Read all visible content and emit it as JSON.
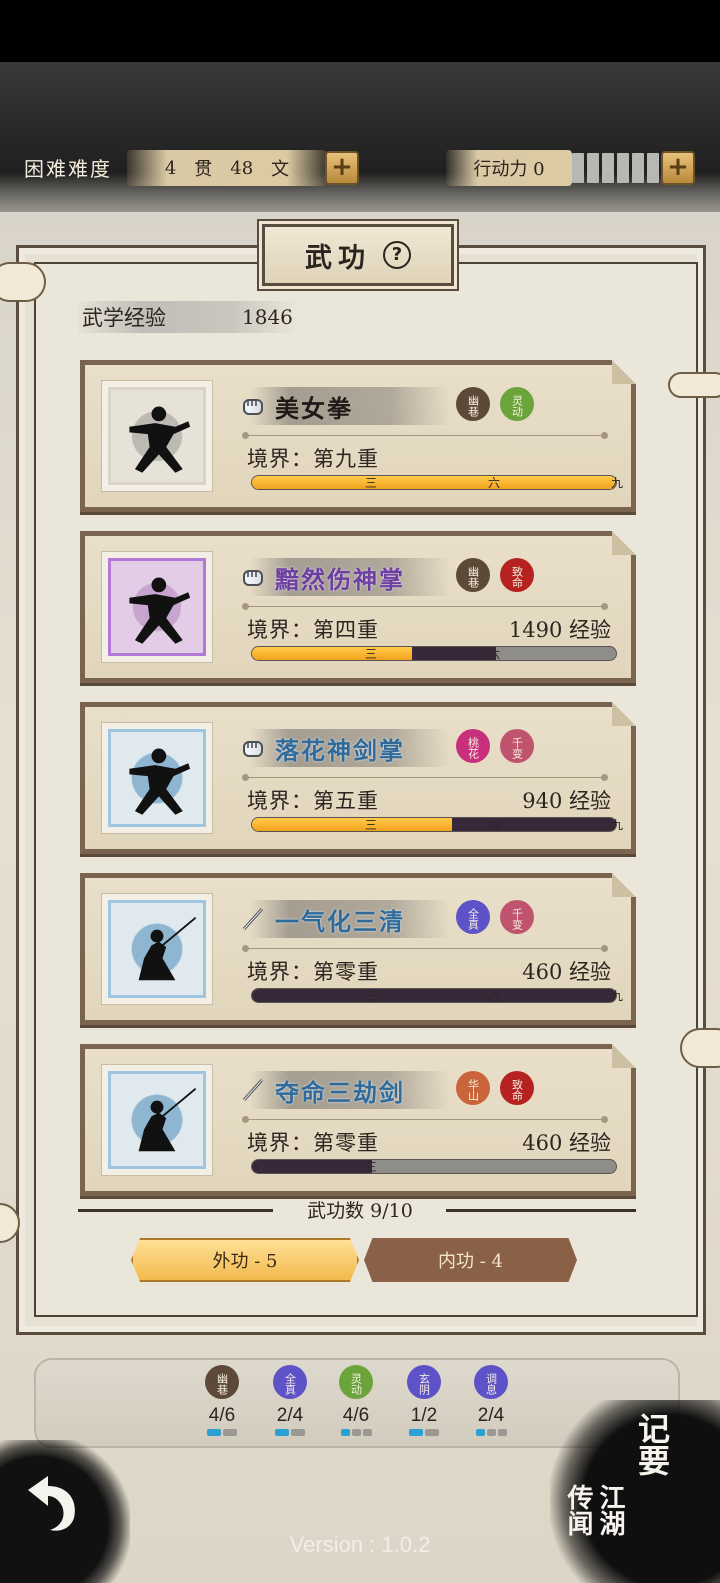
{
  "header": {
    "difficulty": "困难难度",
    "money": {
      "guan": "4",
      "guan_unit": "贯",
      "wen": "48",
      "wen_unit": "文"
    },
    "action_label": "行动力 0",
    "plus": "+"
  },
  "panel": {
    "title": "武功",
    "help": "?",
    "exp_label": "武学经验",
    "exp_value": "1846"
  },
  "skills": [
    {
      "name": "美女拳",
      "realm": "境界：第九重",
      "xp": "",
      "seals": [
        "幽巷",
        "灵动"
      ],
      "progress": 1.0,
      "ticks": [
        "三",
        "六",
        "九"
      ]
    },
    {
      "name": "黯然伤神掌",
      "realm": "境界：第四重",
      "xp": "1490 经验",
      "seals": [
        "幽巷",
        "致命"
      ],
      "progress": 0.44,
      "ticks": [
        "三",
        "六"
      ]
    },
    {
      "name": "落花神剑掌",
      "realm": "境界：第五重",
      "xp": "940 经验",
      "seals": [
        "桃花",
        "千变"
      ],
      "progress": 0.55,
      "ticks": [
        "三",
        "六",
        "九"
      ]
    },
    {
      "name": "一气化三清",
      "realm": "境界：第零重",
      "xp": "460 经验",
      "seals": [
        "全真",
        "千变"
      ],
      "progress": 0.0,
      "ticks": [
        "三",
        "六",
        "九"
      ]
    },
    {
      "name": "夺命三劫剑",
      "realm": "境界：第零重",
      "xp": "460 经验",
      "seals": [
        "华山",
        "致命"
      ],
      "progress": 0.0,
      "ticks": [
        "三"
      ]
    }
  ],
  "footer": {
    "count": "武功数 9/10",
    "tab_outer": "外功 - 5",
    "tab_inner": "内功 - 4"
  },
  "stats": [
    {
      "seal": "幽巷",
      "value": "4/6"
    },
    {
      "seal": "全真",
      "value": "2/4"
    },
    {
      "seal": "灵动",
      "value": "4/6"
    },
    {
      "seal": "玄阴",
      "value": "1/2"
    },
    {
      "seal": "调息",
      "value": "2/4"
    }
  ],
  "corner": {
    "notes": "记要",
    "rumors": "江湖传闻"
  },
  "version": "Version : 1.0.2",
  "colors": {
    "accent": "#f3a21d",
    "dark_fill": "#38293a"
  }
}
